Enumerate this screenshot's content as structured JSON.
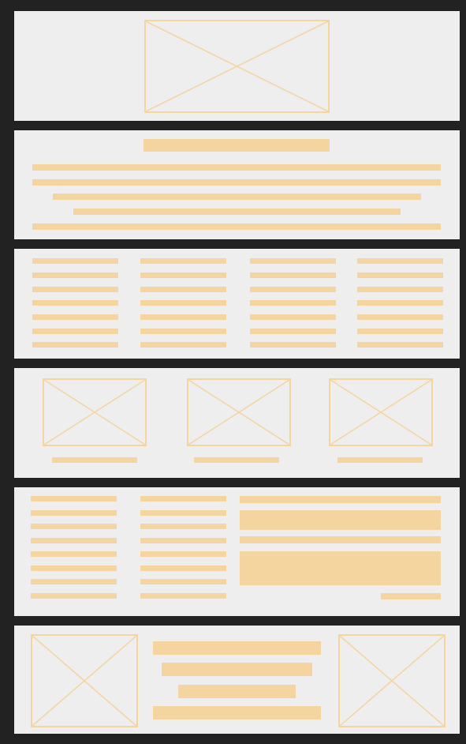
{
  "wireframe": {
    "background": "#222222",
    "panel_color": "#eeeeee",
    "accent_color": "#f4d49f",
    "sections": [
      "hero-image",
      "title-and-paragraph",
      "four-column-text",
      "three-image-cards",
      "two-columns-and-content-block",
      "image-text-image"
    ]
  }
}
